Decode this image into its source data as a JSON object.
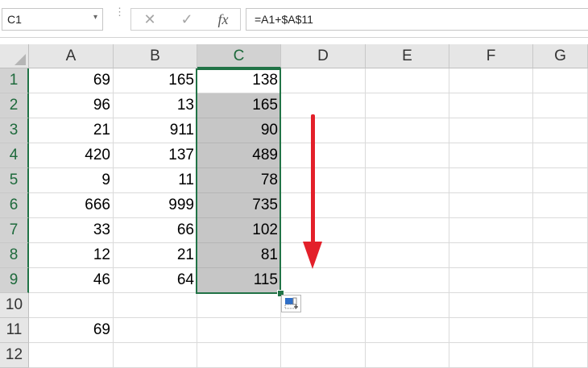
{
  "formula_bar": {
    "name_box": "C1",
    "name_box_arrow": "▾",
    "dots": "⋮",
    "cancel_glyph": "✕",
    "enter_glyph": "✓",
    "fx_glyph": "fx",
    "formula": "=A1+$A$11"
  },
  "columns": [
    "A",
    "B",
    "C",
    "D",
    "E",
    "F",
    "G"
  ],
  "rows": [
    "1",
    "2",
    "3",
    "4",
    "5",
    "6",
    "7",
    "8",
    "9",
    "10",
    "11",
    "12"
  ],
  "cells": {
    "A": [
      "69",
      "96",
      "21",
      "420",
      "9",
      "666",
      "33",
      "12",
      "46",
      "",
      "69",
      ""
    ],
    "B": [
      "165",
      "13",
      "911",
      "137",
      "11",
      "999",
      "66",
      "21",
      "64",
      "",
      "",
      ""
    ],
    "C": [
      "138",
      "165",
      "90",
      "489",
      "78",
      "735",
      "102",
      "81",
      "115",
      "",
      "",
      ""
    ]
  },
  "selection": {
    "active_cell": "C1",
    "range": "C1:C9"
  },
  "colors": {
    "selection_border": "#217346",
    "annotation_arrow": "#e3202a",
    "selected_fill": "#c6c6c6"
  },
  "icons": {
    "autofill_options": "autofill-options-icon",
    "annotation": "down-arrow-annotation"
  }
}
